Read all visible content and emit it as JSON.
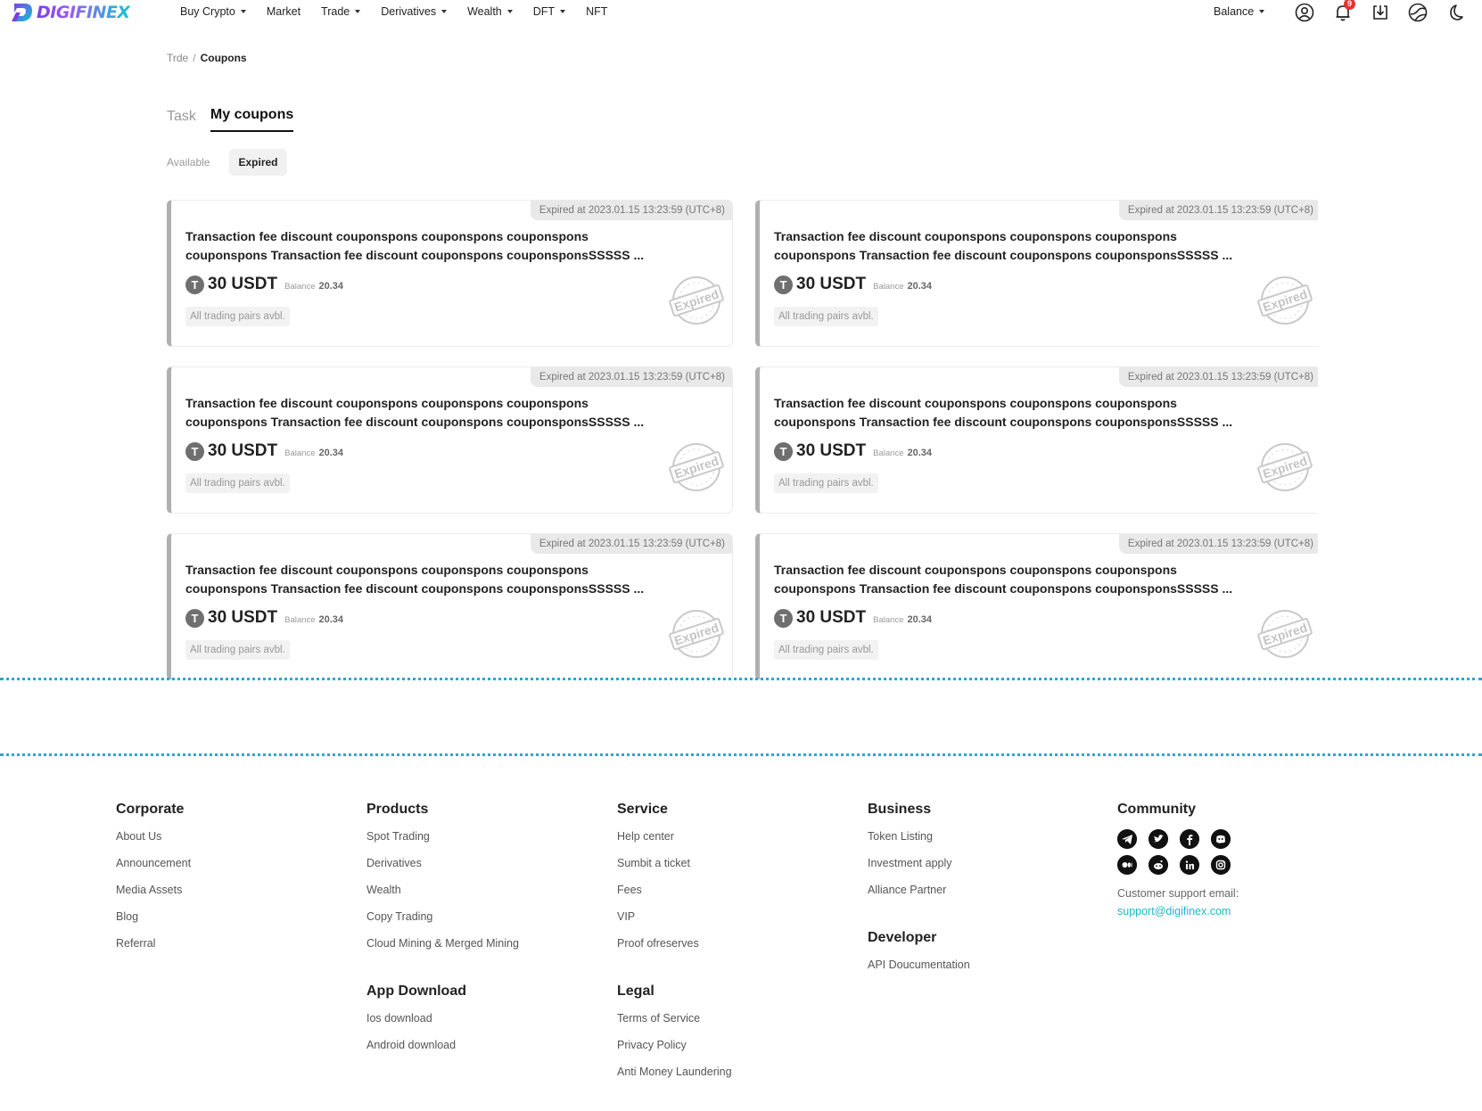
{
  "header": {
    "logo_text": "DIGIFINEX",
    "nav": [
      {
        "label": "Buy Crypto",
        "caret": true
      },
      {
        "label": "Market",
        "caret": false
      },
      {
        "label": "Trade",
        "caret": true
      },
      {
        "label": "Derivatives",
        "caret": true
      },
      {
        "label": "Wealth",
        "caret": true
      },
      {
        "label": "DFT",
        "caret": true
      },
      {
        "label": "NFT",
        "caret": false
      }
    ],
    "balance_label": "Balance",
    "notification_count": "9",
    "icons": [
      "user-icon",
      "bell-icon",
      "download-icon",
      "globe-icon",
      "moon-icon"
    ]
  },
  "breadcrumb": {
    "parent": "Trde",
    "separator": "/",
    "current": "Coupons"
  },
  "tabs": [
    {
      "label": "Task",
      "active": false
    },
    {
      "label": "My coupons",
      "active": true
    }
  ],
  "subtabs": [
    {
      "label": "Available",
      "active": false
    },
    {
      "label": "Expired",
      "active": true
    }
  ],
  "coupons": [
    {
      "expired_at": "Expired at 2023.01.15 13:23:59 (UTC+8)",
      "title": "Transaction fee discount couponspons couponspons couponspons couponspons Transaction fee discount couponspons  couponsponsSSSSS ...",
      "coin_glyph": "T",
      "amount": "30 USDT",
      "balance_label": "Balance",
      "balance_value": "20.34",
      "pairs": "All trading pairs avbl.",
      "stamp": "Expired"
    },
    {
      "expired_at": "Expired at 2023.01.15 13:23:59 (UTC+8)",
      "title": "Transaction fee discount couponspons couponspons couponspons couponspons Transaction fee discount couponspons  couponsponsSSSSS ...",
      "coin_glyph": "T",
      "amount": "30 USDT",
      "balance_label": "Balance",
      "balance_value": "20.34",
      "pairs": "All trading pairs avbl.",
      "stamp": "Expired"
    },
    {
      "expired_at": "Expired at 2023.01.15 13:23:59 (UTC+8)",
      "title": "Transaction fee discount couponspons couponspons couponspons couponspons Transaction fee discount couponspons  couponsponsSSSSS ...",
      "coin_glyph": "T",
      "amount": "30 USDT",
      "balance_label": "Balance",
      "balance_value": "20.34",
      "pairs": "All trading pairs avbl.",
      "stamp": "Expired"
    },
    {
      "expired_at": "Expired at 2023.01.15 13:23:59 (UTC+8)",
      "title": "Transaction fee discount couponspons couponspons couponspons couponspons Transaction fee discount couponspons  couponsponsSSSSS ...",
      "coin_glyph": "T",
      "amount": "30 USDT",
      "balance_label": "Balance",
      "balance_value": "20.34",
      "pairs": "All trading pairs avbl.",
      "stamp": "Expired"
    },
    {
      "expired_at": "Expired at 2023.01.15 13:23:59 (UTC+8)",
      "title": "Transaction fee discount couponspons couponspons couponspons couponspons Transaction fee discount couponspons  couponsponsSSSSS ...",
      "coin_glyph": "T",
      "amount": "30 USDT",
      "balance_label": "Balance",
      "balance_value": "20.34",
      "pairs": "All trading pairs avbl.",
      "stamp": "Expired"
    },
    {
      "expired_at": "Expired at 2023.01.15 13:23:59 (UTC+8)",
      "title": "Transaction fee discount couponspons couponspons couponspons couponspons Transaction fee discount couponspons  couponsponsSSSSS ...",
      "coin_glyph": "T",
      "amount": "30 USDT",
      "balance_label": "Balance",
      "balance_value": "20.34",
      "pairs": "All trading pairs avbl.",
      "stamp": "Expired"
    }
  ],
  "footer": {
    "corporate": {
      "heading": "Corporate",
      "links": [
        "About Us",
        "Announcement",
        "Media Assets",
        "Blog",
        "Referral"
      ]
    },
    "products": {
      "heading": "Products",
      "links": [
        "Spot Trading",
        "Derivatives",
        "Wealth",
        "Copy Trading",
        "Cloud Mining & Merged Mining"
      ]
    },
    "app_download": {
      "heading": "App Download",
      "links": [
        "Ios download",
        "Android download"
      ]
    },
    "service": {
      "heading": "Service",
      "links": [
        "Help center",
        "Sumbit a ticket",
        "Fees",
        "VIP",
        "Proof ofreserves"
      ]
    },
    "legal": {
      "heading": "Legal",
      "links": [
        "Terms of Service",
        "Privacy Policy",
        "Anti Money Laundering"
      ]
    },
    "business": {
      "heading": "Business",
      "links": [
        "Token Listing",
        "Investment apply",
        "Alliance Partner"
      ]
    },
    "developer": {
      "heading": "Developer",
      "links": [
        "API Doucumentation"
      ]
    },
    "community": {
      "heading": "Community",
      "social_icons": [
        "telegram-icon",
        "twitter-icon",
        "facebook-icon",
        "discord-icon",
        "medium-icon",
        "reddit-icon",
        "linkedin-icon",
        "instagram-icon"
      ],
      "support_label": "Customer support email:",
      "support_email": "support@digifinex.com"
    }
  },
  "colors": {
    "brand_purple": "#7b3fe4",
    "brand_cyan": "#16c4d8",
    "badge_red": "#e8312f",
    "link_teal": "#1fb6c9",
    "dashed_line": "#2aa7d6"
  }
}
